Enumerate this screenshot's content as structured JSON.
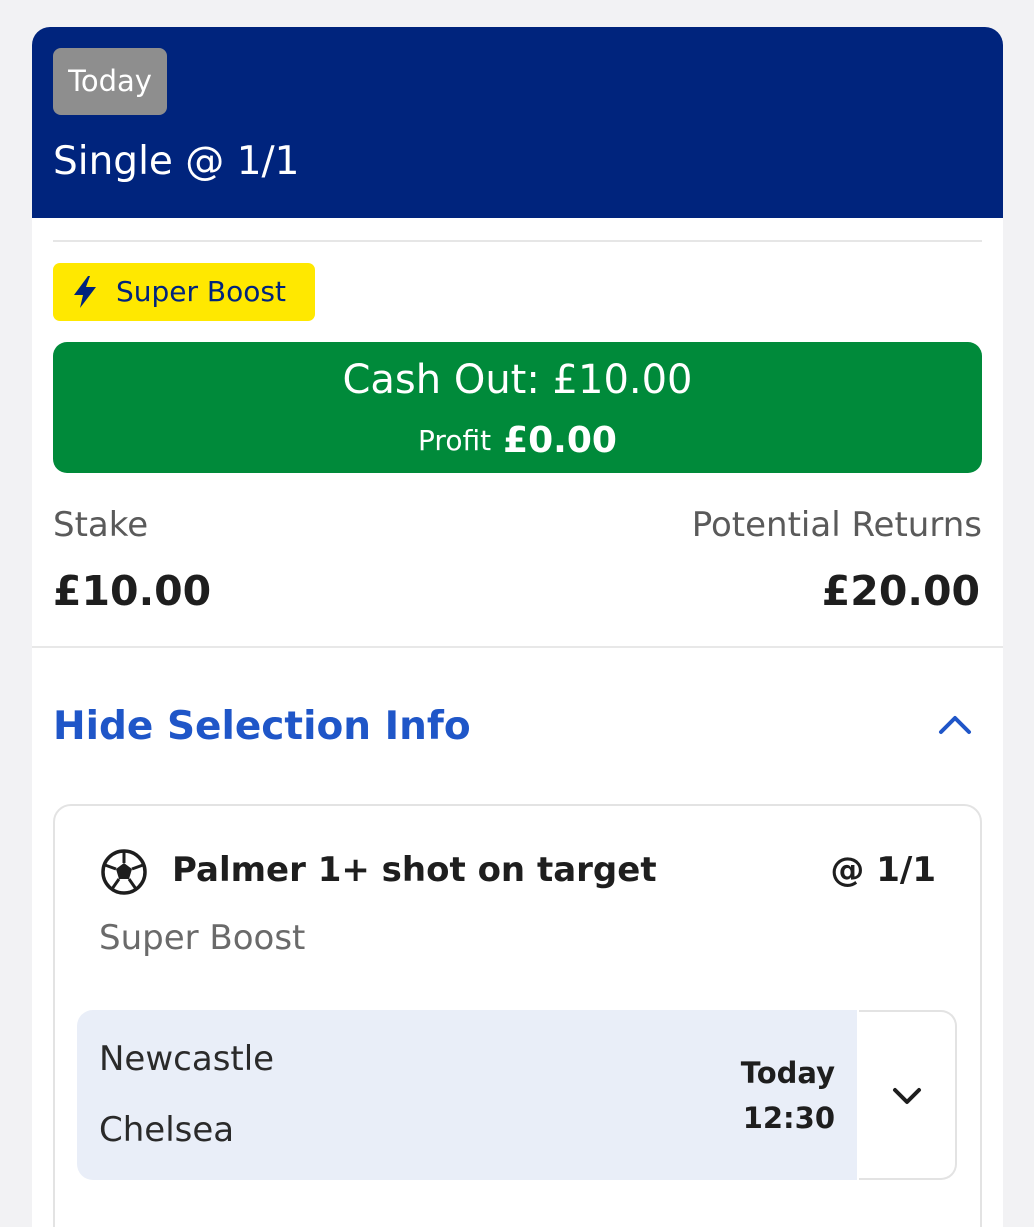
{
  "bet": {
    "date_chip": "Today",
    "title": "Single @ 1/1",
    "boost_badge": "Super Boost"
  },
  "cash_out": {
    "label": "Cash Out: £10.00",
    "profit_label": "Profit",
    "profit_value": "£0.00"
  },
  "summary": {
    "stake_label": "Stake",
    "stake_value": "£10.00",
    "returns_label": "Potential Returns",
    "returns_value": "£20.00"
  },
  "selection_toggle": {
    "label": "Hide Selection Info"
  },
  "selection": {
    "name": "Palmer 1+ shot on target",
    "odds": "@ 1/1",
    "market": "Super Boost",
    "event": {
      "home_team": "Newcastle",
      "away_team": "Chelsea",
      "day": "Today",
      "time": "12:30"
    }
  },
  "colors": {
    "header": "#00247d",
    "boost": "#ffe800",
    "cash_out": "#008a3a",
    "link": "#1f56c8",
    "event_bg": "#e9eef8"
  },
  "icons": {
    "boost": "lightning-bolt-icon",
    "toggle": "chevron-up-icon",
    "sport": "football-icon",
    "expand": "chevron-down-icon"
  }
}
